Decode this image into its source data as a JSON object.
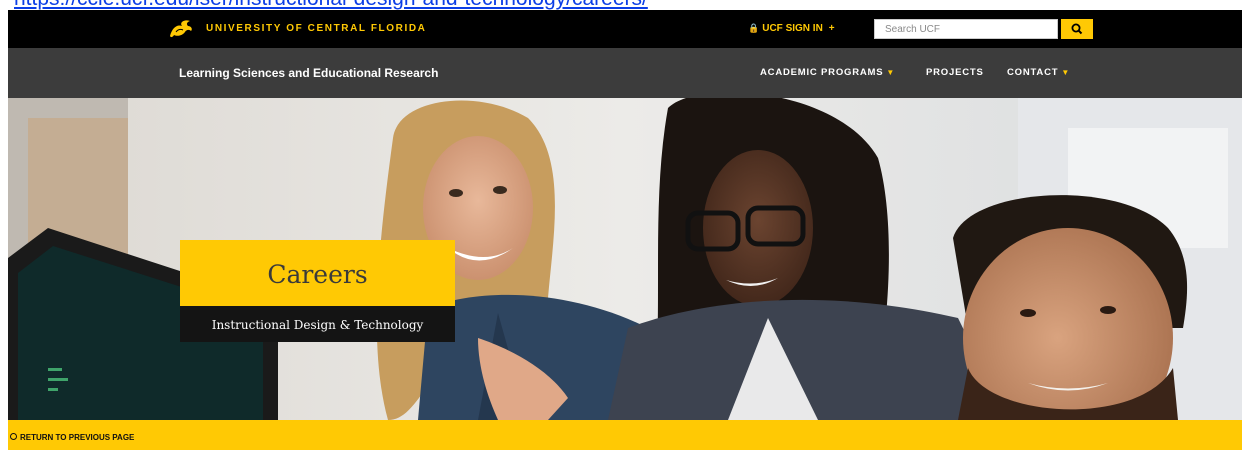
{
  "url": {
    "text": "https://ccie.ucf.edu/lser/instructional-design-and-technology/careers/"
  },
  "ucf_bar": {
    "university_name": "UNIVERSITY OF CENTRAL FLORIDA",
    "signin_prefix": "UCF",
    "signin_label": "SIGN IN",
    "signin_plus": "+",
    "search_placeholder": "Search UCF",
    "search_icon": "search-icon"
  },
  "site_nav": {
    "title": "Learning Sciences and Educational Research",
    "items": [
      {
        "label": "ACADEMIC PROGRAMS",
        "has_dropdown": true
      },
      {
        "label": "PROJECTS",
        "has_dropdown": false
      },
      {
        "label": "CONTACT",
        "has_dropdown": true
      }
    ]
  },
  "hero": {
    "title": "Careers",
    "subtitle": "Instructional Design & Technology",
    "image": "photo-three-students-looking-at-computer"
  },
  "return_bar": {
    "label": "RETURN TO PREVIOUS PAGE",
    "icon": "circle-icon"
  },
  "colors": {
    "ucf_gold": "#ffc904",
    "ucf_black": "#000000",
    "nav_grey": "#3c3c3c",
    "link_blue": "#0b3ee6"
  }
}
